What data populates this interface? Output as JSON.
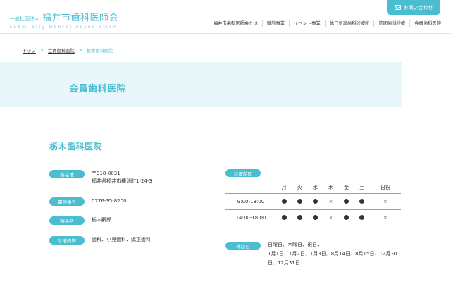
{
  "header": {
    "logo_small": "一般社団法人",
    "logo_main": "福井市歯科医師会",
    "logo_en": "Fukui city Dental Association",
    "contact_label": "お問い合わせ",
    "nav": [
      "福井市歯科医師会とは",
      "健診事業",
      "イベント事業",
      "休日急患歯科診療所",
      "訪問歯科診療",
      "会員歯科医院"
    ]
  },
  "breadcrumb": {
    "home": "トップ",
    "parent": "会員歯科医院",
    "current": "栃木歯科医院"
  },
  "page_title": "会員歯科医院",
  "clinic": {
    "name": "栃木歯科医院",
    "address_label": "所在地",
    "postal": "〒918-8031",
    "address": "福井県福井市種池町1-24-3",
    "phone_label": "電話番号",
    "phone": "0776-35-8200",
    "director_label": "院長名",
    "director": "栃木嗣郎",
    "services_label": "診療内容",
    "services": "歯科、小児歯科、矯正歯科"
  },
  "hours": {
    "label": "診療時間",
    "days": [
      "月",
      "火",
      "水",
      "木",
      "金",
      "土",
      "日祝"
    ],
    "rows": [
      {
        "time": "9:00-13:00",
        "marks": [
          "●",
          "●",
          "●",
          "×",
          "●",
          "●",
          "×"
        ]
      },
      {
        "time": "14:00-18:00",
        "marks": [
          "●",
          "●",
          "●",
          "×",
          "●",
          "●",
          "×"
        ]
      }
    ]
  },
  "closed": {
    "label": "休診日",
    "line1": "日曜日、木曜日、祝日、",
    "line2": "1月1日、1月2日、1月3日、8月14日、8月15日、12月30日、12月31日"
  }
}
